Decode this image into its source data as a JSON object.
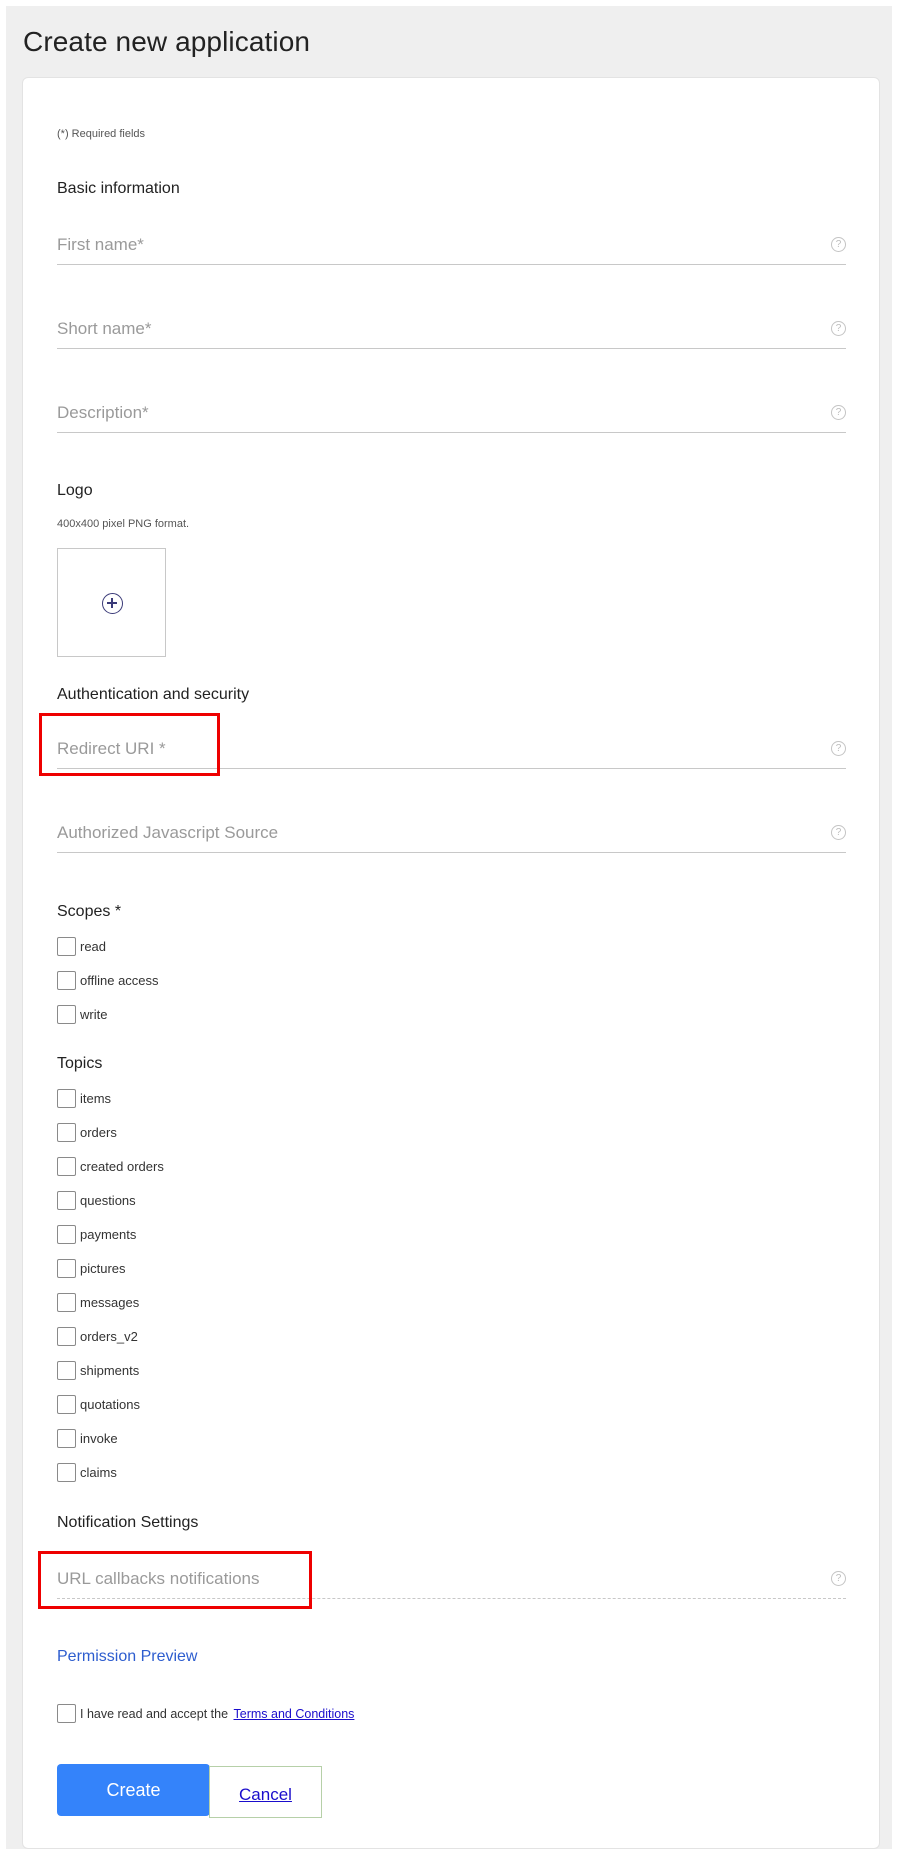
{
  "page": {
    "title": "Create new application"
  },
  "form": {
    "required_note": "(*) Required fields",
    "basic_info": {
      "title": "Basic information",
      "first_name": {
        "placeholder": "First name*",
        "value": ""
      },
      "short_name": {
        "placeholder": "Short name*",
        "value": ""
      },
      "description": {
        "placeholder": "Description*",
        "value": ""
      }
    },
    "logo": {
      "title": "Logo",
      "hint": "400x400 pixel PNG format."
    },
    "auth": {
      "title": "Authentication and security",
      "redirect_uri": {
        "placeholder": "Redirect URI *",
        "value": ""
      },
      "js_source": {
        "placeholder": "Authorized Javascript Source",
        "value": ""
      }
    },
    "scopes": {
      "title": "Scopes *",
      "items": [
        "read",
        "offline access",
        "write"
      ]
    },
    "topics": {
      "title": "Topics",
      "items": [
        "items",
        "orders",
        "created orders",
        "questions",
        "payments",
        "pictures",
        "messages",
        "orders_v2",
        "shipments",
        "quotations",
        "invoke",
        "claims"
      ]
    },
    "notifications": {
      "title": "Notification Settings",
      "callback_url": {
        "placeholder": "URL callbacks notifications",
        "value": ""
      }
    },
    "permission_preview": "Permission Preview",
    "terms": {
      "text": "I have read and accept the",
      "link": "Terms and Conditions"
    },
    "buttons": {
      "create": "Create",
      "cancel": "Cancel"
    },
    "help_glyph": "?"
  },
  "colors": {
    "primary_button": "#3483fa",
    "link": "#2d5dcf",
    "highlight": "#ee0000"
  }
}
